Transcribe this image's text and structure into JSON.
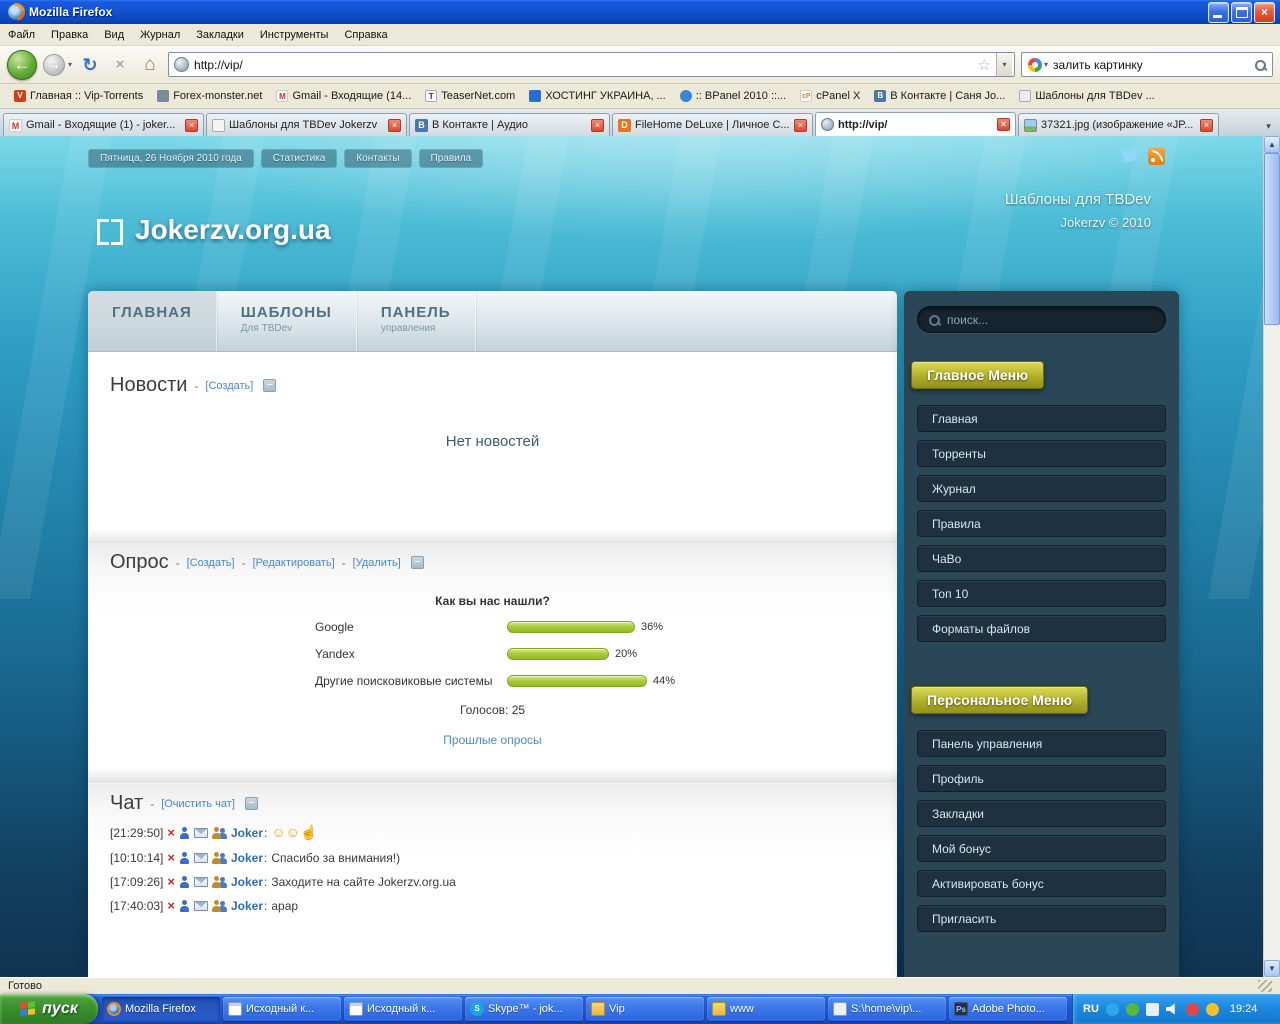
{
  "window": {
    "title": "Mozilla Firefox",
    "status": "Готово"
  },
  "icons": {
    "close": "×",
    "collapse": "−",
    "back": "←",
    "forward": "→",
    "reload": "↻",
    "home": "⌂",
    "star": "☆",
    "dropdown": "▾",
    "up": "▲",
    "down": "▼"
  },
  "menubar": {
    "items": [
      "Файл",
      "Правка",
      "Вид",
      "Журнал",
      "Закладки",
      "Инструменты",
      "Справка"
    ]
  },
  "navbar": {
    "url": "http://vip/",
    "search_value": "залить картинку"
  },
  "bookmarks": {
    "items": [
      "Главная :: Vip-Torrents",
      "Forex-monster.net",
      "Gmail - Входящие (14...",
      "TeaserNet.com",
      "ХОСТИНГ УКРАИНА, ...",
      ":: BPanel 2010 ::...",
      "cPanel X",
      "В Контакте | Саня Jo...",
      "Шаблоны для TBDev ..."
    ]
  },
  "tabs": {
    "items": [
      {
        "label": "Gmail - Входящие (1) - joker..."
      },
      {
        "label": "Шаблоны для TBDev Jokerzv"
      },
      {
        "label": "В Контакте | Аудио"
      },
      {
        "label": "FileHome DeLuxe | Личное С..."
      },
      {
        "label": "http://vip/"
      },
      {
        "label": "37321.jpg (изображение «JP..."
      }
    ]
  },
  "site": {
    "topbar": {
      "date": "Пятница, 26 Ноября 2010 года",
      "links": [
        "Статистика",
        "Контакты",
        "Правила"
      ]
    },
    "logo": "Jokerzv.org.ua",
    "tagline1": "Шаблоны для TBDev",
    "tagline2": "Jokerzv © 2010",
    "nav": [
      {
        "title": "ГЛАВНАЯ",
        "sub": ""
      },
      {
        "title": "ШАБЛОНЫ",
        "sub": "Для TBDev"
      },
      {
        "title": "ПАНЕЛЬ",
        "sub": "управления"
      }
    ],
    "sep": "-",
    "news": {
      "title": "Новости",
      "create": "[Создать]",
      "empty": "Нет новостей"
    },
    "poll": {
      "title": "Опрос",
      "create": "[Создать]",
      "edit": "[Редактировать]",
      "delete": "[Удалить]",
      "question": "Как вы нас нашли?",
      "options": [
        {
          "label": "Google",
          "percent": 36,
          "percent_label": "36%"
        },
        {
          "label": "Yandex",
          "percent": 20,
          "percent_label": "20%"
        },
        {
          "label": "Другие поисковиковые системы",
          "percent": 44,
          "percent_label": "44%"
        }
      ],
      "votes": "Голосов: 25",
      "past_link": "Прошлые опросы"
    },
    "chat": {
      "title": "Чат",
      "clear": "[Очистить чат]",
      "colon": ":",
      "messages": [
        {
          "time": "[21:29:50]",
          "user": "Joker",
          "text": "",
          "emoji": "☺☺☝"
        },
        {
          "time": "[10:10:14]",
          "user": "Joker",
          "text": "Спасибо за внимания!)",
          "emoji": ""
        },
        {
          "time": "[17:09:26]",
          "user": "Joker",
          "text": "Заходите на сайте Jokerzv.org.ua",
          "emoji": ""
        },
        {
          "time": "[17:40:03]",
          "user": "Joker",
          "text": "арар",
          "emoji": ""
        }
      ]
    },
    "sidebar": {
      "search_placeholder": "поиск...",
      "main_title": "Главное Меню",
      "main_items": [
        "Главная",
        "Торренты",
        "Журнал",
        "Правила",
        "ЧаВо",
        "Топ 10",
        "Форматы файлов"
      ],
      "personal_title": "Персональное Меню",
      "personal_items": [
        "Панель управления",
        "Профиль",
        "Закладки",
        "Мой бонус",
        "Активировать бонус",
        "Пригласить"
      ]
    }
  },
  "taskbar": {
    "start": "пуск",
    "buttons": [
      {
        "label": "Mozilla Firefox"
      },
      {
        "label": "Исходный к..."
      },
      {
        "label": "Исходный к..."
      },
      {
        "label": "Skype™ - jok..."
      },
      {
        "label": "Vip"
      },
      {
        "label": "www"
      },
      {
        "label": "S:\\home\\vip\\..."
      },
      {
        "label": "Adobe Photo..."
      }
    ],
    "lang": "RU",
    "clock": "19:24"
  }
}
